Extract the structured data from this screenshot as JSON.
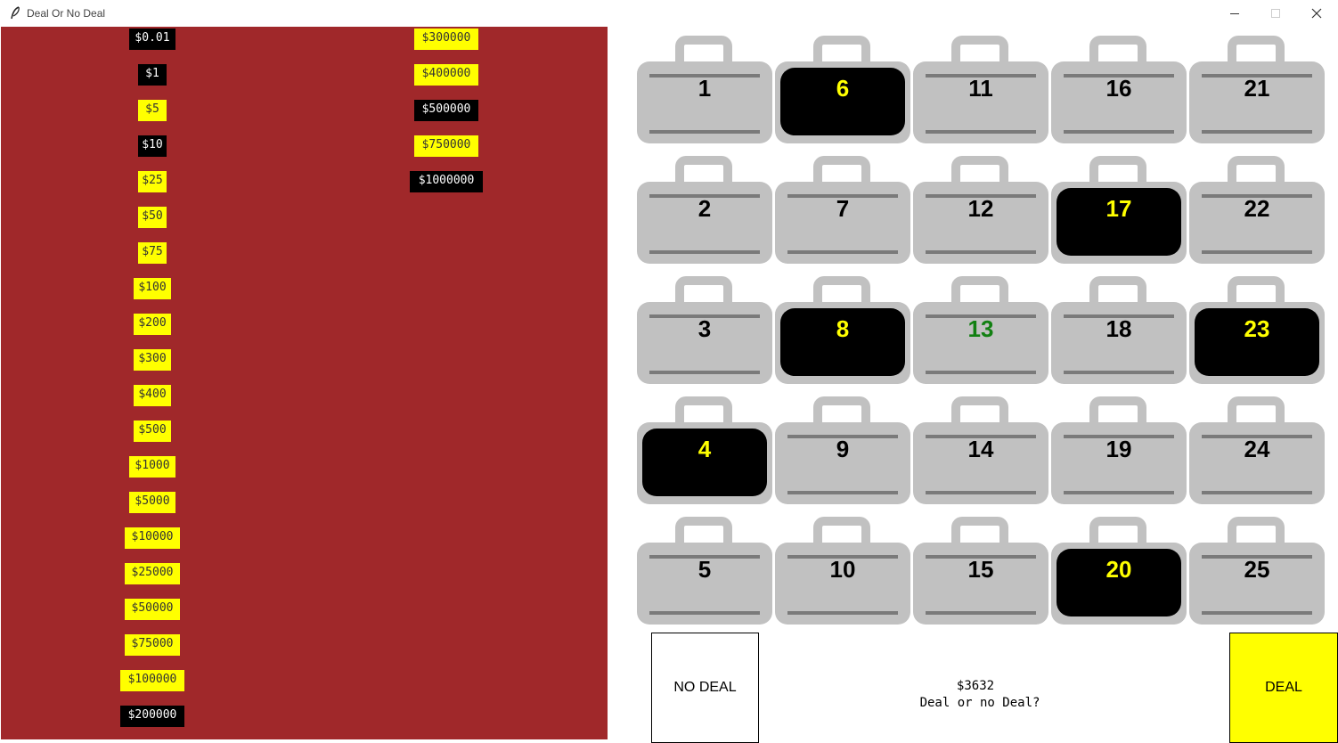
{
  "window": {
    "title": "Deal Or No Deal"
  },
  "money_board": {
    "left_column": [
      {
        "label": "$0.01",
        "eliminated": true
      },
      {
        "label": "$1",
        "eliminated": true
      },
      {
        "label": "$5",
        "eliminated": false
      },
      {
        "label": "$10",
        "eliminated": true
      },
      {
        "label": "$25",
        "eliminated": false
      },
      {
        "label": "$50",
        "eliminated": false
      },
      {
        "label": "$75",
        "eliminated": false
      },
      {
        "label": "$100",
        "eliminated": false
      },
      {
        "label": "$200",
        "eliminated": false
      },
      {
        "label": "$300",
        "eliminated": false
      },
      {
        "label": "$400",
        "eliminated": false
      },
      {
        "label": "$500",
        "eliminated": false
      },
      {
        "label": "$1000",
        "eliminated": false
      },
      {
        "label": "$5000",
        "eliminated": false
      },
      {
        "label": "$10000",
        "eliminated": false
      },
      {
        "label": "$25000",
        "eliminated": false
      },
      {
        "label": "$50000",
        "eliminated": false
      },
      {
        "label": "$75000",
        "eliminated": false
      },
      {
        "label": "$100000",
        "eliminated": false
      },
      {
        "label": "$200000",
        "eliminated": true
      }
    ],
    "right_column": [
      {
        "label": "$300000",
        "eliminated": false
      },
      {
        "label": "$400000",
        "eliminated": false
      },
      {
        "label": "$500000",
        "eliminated": true
      },
      {
        "label": "$750000",
        "eliminated": false
      },
      {
        "label": "$1000000",
        "eliminated": true
      }
    ]
  },
  "cases": [
    {
      "number": "1",
      "state": "closed"
    },
    {
      "number": "2",
      "state": "closed"
    },
    {
      "number": "3",
      "state": "closed"
    },
    {
      "number": "4",
      "state": "opened"
    },
    {
      "number": "5",
      "state": "closed"
    },
    {
      "number": "6",
      "state": "opened"
    },
    {
      "number": "7",
      "state": "closed"
    },
    {
      "number": "8",
      "state": "opened"
    },
    {
      "number": "9",
      "state": "closed"
    },
    {
      "number": "10",
      "state": "closed"
    },
    {
      "number": "11",
      "state": "closed"
    },
    {
      "number": "12",
      "state": "closed"
    },
    {
      "number": "13",
      "state": "selected"
    },
    {
      "number": "14",
      "state": "closed"
    },
    {
      "number": "15",
      "state": "closed"
    },
    {
      "number": "16",
      "state": "closed"
    },
    {
      "number": "17",
      "state": "opened"
    },
    {
      "number": "18",
      "state": "closed"
    },
    {
      "number": "19",
      "state": "closed"
    },
    {
      "number": "20",
      "state": "opened"
    },
    {
      "number": "21",
      "state": "closed"
    },
    {
      "number": "22",
      "state": "closed"
    },
    {
      "number": "23",
      "state": "opened"
    },
    {
      "number": "24",
      "state": "closed"
    },
    {
      "number": "25",
      "state": "closed"
    }
  ],
  "controls": {
    "no_deal_label": "NO DEAL",
    "deal_label": "DEAL"
  },
  "banker": {
    "offer": "$3632",
    "prompt": "Deal or no Deal?"
  },
  "colors": {
    "board_background": "#a0282a",
    "remaining_amount": "#ffff00",
    "eliminated_amount": "#000000",
    "case_body": "#c1c1c1",
    "opened_case_number": "#ffff00",
    "selected_case_number": "#128012",
    "deal_button": "#ffff00"
  },
  "icons": {
    "app": "feather-icon",
    "minimize": "minimize-icon",
    "maximize": "maximize-icon",
    "close": "close-icon"
  }
}
